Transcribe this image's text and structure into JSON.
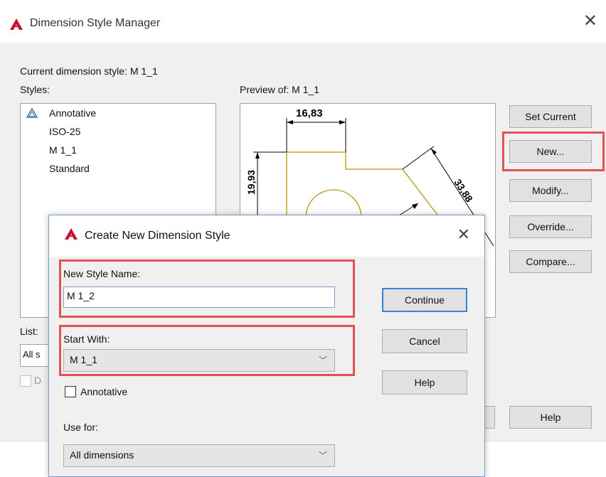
{
  "window": {
    "title": "Dimension Style Manager",
    "current_style_label": "Current dimension style: M 1_1",
    "styles_label": "Styles:",
    "preview_label": "Preview of: M 1_1",
    "list_label": "List:",
    "list_value_partial": "All s",
    "checkbox_partial": "D",
    "styles": [
      "Annotative",
      "ISO-25",
      "M 1_1",
      "Standard"
    ],
    "preview": {
      "dim_top": "16,83",
      "dim_left": "19,93",
      "dim_angle": "33,88"
    },
    "buttons": {
      "set_current": "Set Current",
      "new": "New...",
      "modify": "Modify...",
      "override": "Override...",
      "compare": "Compare...",
      "help": "Help"
    }
  },
  "dialog": {
    "title": "Create New Dimension Style",
    "new_style_name_label": "New Style Name:",
    "new_style_name_value": "M 1_2",
    "start_with_label": "Start With:",
    "start_with_value": "M 1_1",
    "annotative_label": "Annotative",
    "use_for_label": "Use for:",
    "use_for_value": "All dimensions",
    "buttons": {
      "continue": "Continue",
      "cancel": "Cancel",
      "help": "Help"
    }
  },
  "colors": {
    "highlight_red": "#e05252",
    "geometry_yellow": "#b8960c",
    "autocad_red": "#c8102e"
  }
}
